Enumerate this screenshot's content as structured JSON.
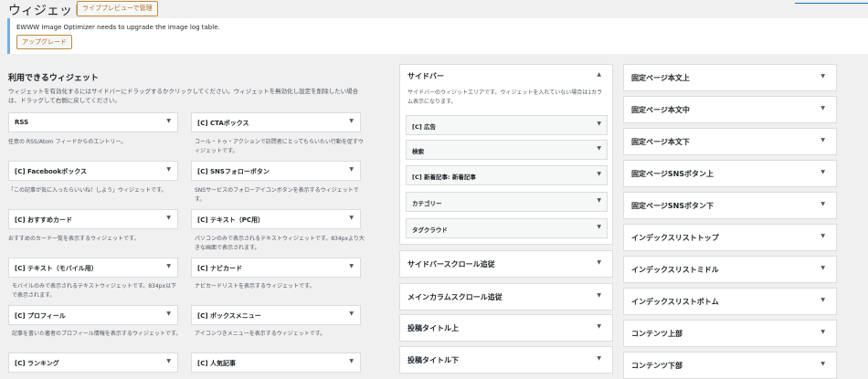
{
  "header": {
    "title": "ウィジェット",
    "live_preview_button": "ライブプレビューで管理"
  },
  "notice": {
    "text": "EWWW Image Optimizer needs to upgrade the image log table.",
    "button": "アップグレード"
  },
  "available": {
    "title": "利用できるウィジェット",
    "description": "ウィジェットを有効化するにはサイドバーにドラッグするかクリックしてください。ウィジェットを無効化し設定を削除したい場合は、ドラッグして右側に戻してください。",
    "widgets": [
      {
        "label": "RSS",
        "desc": "任意の RSS/Atom フィードからのエントリー。"
      },
      {
        "label": "[C] CTAボックス",
        "desc": "コール・トゥ・アクションで訪問者にとってもらいたい行動を促すウィジェットです。"
      },
      {
        "label": "[C] Facebookボックス",
        "desc": "「この記事が気に入ったらいいね！しよう」ウィジェットです。"
      },
      {
        "label": "[C] SNSフォローボタン",
        "desc": "SNSサービスのフォローアイコンボタンを表示するウィジェットです。"
      },
      {
        "label": "[C] おすすめカード",
        "desc": "おすすめのカード一覧を表示するウィジェットです。"
      },
      {
        "label": "[C] テキスト（PC用）",
        "desc": "パソコンのみで表示されるテキストウィジェットです。834pxより大きな画面で表示されます。"
      },
      {
        "label": "[C] テキスト（モバイル用）",
        "desc": "モバイルのみで表示されるテキストウィジェットです。834px以下で表示されます。"
      },
      {
        "label": "[C] ナビカード",
        "desc": "ナビカードリストを表示するウィジェットです。"
      },
      {
        "label": "[C] プロフィール",
        "desc": "記事を書いた著者のプロフィール情報を表示するウィジェットです。"
      },
      {
        "label": "[C] ボックスメニュー",
        "desc": "アイコンつきメニューを表示するウィジェットです。"
      },
      {
        "label": "[C] ランキング",
        "desc": ""
      },
      {
        "label": "[C] 人気記事",
        "desc": ""
      }
    ]
  },
  "sidebar": {
    "title": "サイドバー",
    "description": "サイドバーのウィジットエリアです。ウィジェットを入れていない場合は1カラム表示になります。",
    "widgets": [
      "[C] 広告",
      "検索",
      "[C] 新着記事: 新着記事",
      "カテゴリー",
      "タグクラウド"
    ]
  },
  "middle_areas": [
    "サイドバースクロール追従",
    "メインカラムスクロール追従",
    "投稿タイトル上",
    "投稿タイトル下"
  ],
  "right_areas": [
    "固定ページ本文上",
    "固定ページ本文中",
    "固定ページ本文下",
    "固定ページSNSボタン上",
    "固定ページSNSボタン下",
    "インデックスリストトップ",
    "インデックスリストミドル",
    "インデックスリストボトム",
    "コンテンツ上部",
    "コンテンツ下部"
  ],
  "icons": {
    "caret_down": "▼",
    "caret_up": "▲"
  }
}
